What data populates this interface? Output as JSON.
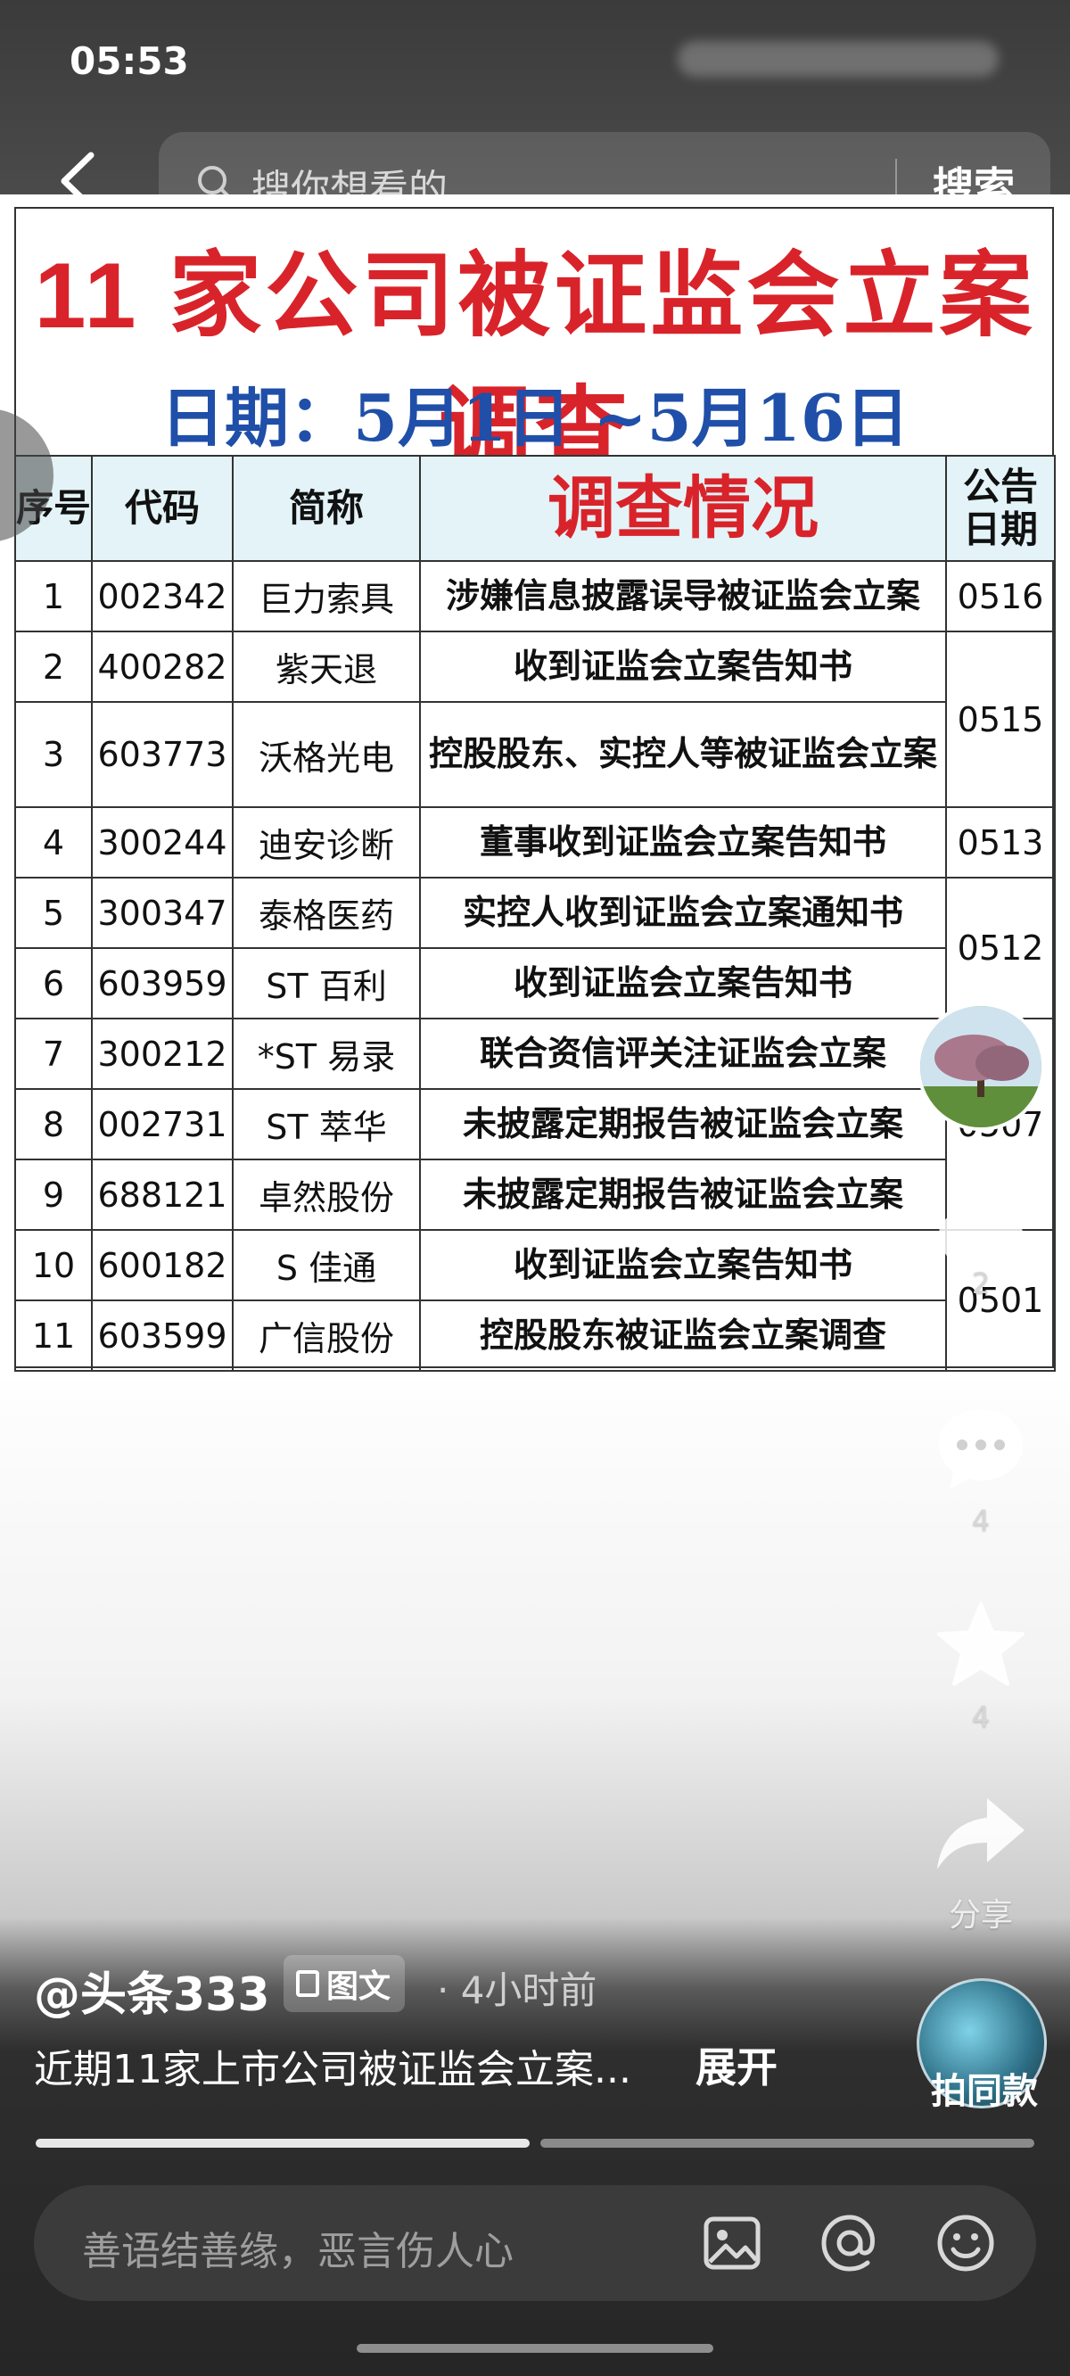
{
  "status_bar": {
    "time": "05:53"
  },
  "search": {
    "placeholder": "搜你想看的",
    "button": "搜索"
  },
  "document": {
    "title": "11 家公司被证监会立案调查",
    "date_range": "日期：5月1日 ~5月16日",
    "table": {
      "headers": [
        "序号",
        "代码",
        "简称",
        "调查情况",
        "公告日期"
      ],
      "rows": [
        {
          "no": "1",
          "code": "002342",
          "name": "巨力索具",
          "desc": "涉嫌信息披露误导被证监会立案",
          "date": "0516"
        },
        {
          "no": "2",
          "code": "400282",
          "name": "紫天退",
          "desc": "收到证监会立案告知书",
          "date": "0515"
        },
        {
          "no": "3",
          "code": "603773",
          "name": "沃格光电",
          "desc": "控股股东、实控人等被证监会立案",
          "date": ""
        },
        {
          "no": "4",
          "code": "300244",
          "name": "迪安诊断",
          "desc": "董事收到证监会立案告知书",
          "date": "0513"
        },
        {
          "no": "5",
          "code": "300347",
          "name": "泰格医药",
          "desc": "实控人收到证监会立案通知书",
          "date": "0512"
        },
        {
          "no": "6",
          "code": "603959",
          "name": "ST 百利",
          "desc": "收到证监会立案告知书",
          "date": ""
        },
        {
          "no": "7",
          "code": "300212",
          "name": "*ST 易录",
          "desc": "联合资信评关注证监会立案",
          "date": "0507"
        },
        {
          "no": "8",
          "code": "002731",
          "name": "ST 萃华",
          "desc": "未披露定期报告被证监会立案",
          "date": ""
        },
        {
          "no": "9",
          "code": "688121",
          "name": "卓然股份",
          "desc": "未披露定期报告被证监会立案",
          "date": ""
        },
        {
          "no": "10",
          "code": "600182",
          "name": "S 佳通",
          "desc": "收到证监会立案告知书",
          "date": "0501"
        },
        {
          "no": "11",
          "code": "603599",
          "name": "广信股份",
          "desc": "控股股东被证监会立案调查",
          "date": ""
        }
      ]
    }
  },
  "actions": {
    "like_count": "2",
    "comment_count": "4",
    "favorite_count": "4",
    "share_label": "分享"
  },
  "post": {
    "author": "@头条333",
    "type_label": "图文",
    "time": "· 4小时前",
    "caption": "近期11家上市公司被证监会立案...",
    "expand": "展开",
    "same_style_label": "拍同款"
  },
  "comment_bar": {
    "placeholder": "善语结善缘，恶言伤人心"
  },
  "colors": {
    "title_red": "#d9232a",
    "date_blue": "#1f4fa8",
    "header_bg": "#e3f3f7"
  }
}
